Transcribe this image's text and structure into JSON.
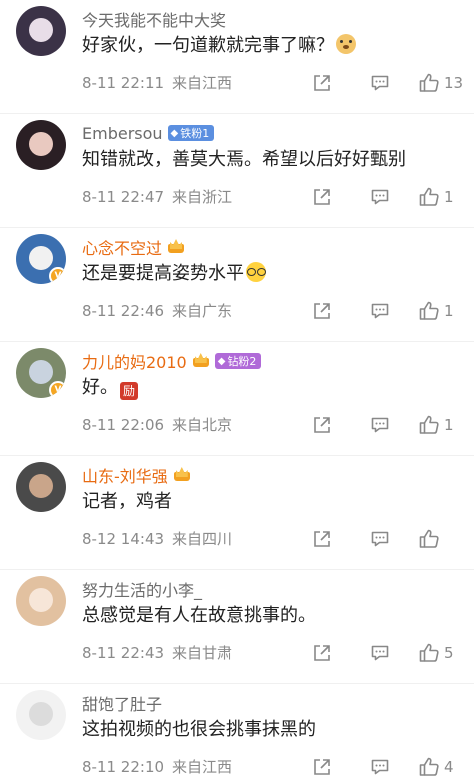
{
  "comments": [
    {
      "username": "今天我能不能中大奖",
      "badge": null,
      "text": "好家伙，一句道歉就完事了嘛？",
      "emoji": "doge-emoji",
      "date": "8-11 22:11",
      "location": "来自江西",
      "likes": "13",
      "avatar_colors": [
        "#3b3247",
        "#e8dde8"
      ]
    },
    {
      "username": "Embersou",
      "badge": {
        "type": "iron",
        "label": "铁粉1"
      },
      "text": "知错就改，善莫大焉。希望以后好好甄别",
      "emoji": null,
      "date": "8-11 22:47",
      "location": "来自浙江",
      "likes": "1",
      "avatar_colors": [
        "#2a1f24",
        "#e9c9c0"
      ]
    },
    {
      "username": "心念不空过",
      "badge": {
        "type": "crown"
      },
      "text": "还是要提高姿势水平",
      "emoji": "glasses-emoji",
      "date": "8-11 22:46",
      "location": "来自广东",
      "likes": "1",
      "avatar_colors": [
        "#3b6fb0",
        "#f1f1f1"
      ],
      "verified": true
    },
    {
      "username": "力儿的妈2010",
      "badge": {
        "type": "crown+drill",
        "label": "钻粉2"
      },
      "text": "好。",
      "emoji": "encourage-sticker",
      "sticker_text": "励",
      "date": "8-11 22:06",
      "location": "来自北京",
      "likes": "1",
      "avatar_colors": [
        "#7c8a6a",
        "#c9d3df"
      ],
      "verified": true
    },
    {
      "username": "山东-刘华强",
      "badge": {
        "type": "crown"
      },
      "text": "记者，鸡者",
      "emoji": null,
      "date": "8-12 14:43",
      "location": "来自四川",
      "likes": "",
      "avatar_colors": [
        "#4a4a4a",
        "#c9a58a"
      ]
    },
    {
      "username": "努力生活的小李_",
      "badge": null,
      "text": "总感觉是有人在故意挑事的。",
      "emoji": null,
      "date": "8-11 22:43",
      "location": "来自甘肃",
      "likes": "5",
      "avatar_colors": [
        "#e2c1a0",
        "#f7e6d8"
      ]
    },
    {
      "username": "甜饱了肚子",
      "badge": null,
      "text": "这拍视频的也很会挑事抹黑的",
      "emoji": null,
      "date": "8-11 22:10",
      "location": "来自江西",
      "likes": "4",
      "avatar_colors": [
        "#f2f2f2",
        "#dcdcdc"
      ]
    }
  ],
  "icons": {
    "share": "share-icon",
    "comment": "comment-icon",
    "like": "thumbs-up-icon"
  },
  "colors": {
    "username_default": "#6b6b6b",
    "username_vip": "#e86b12",
    "meta": "#8a8a8a"
  }
}
